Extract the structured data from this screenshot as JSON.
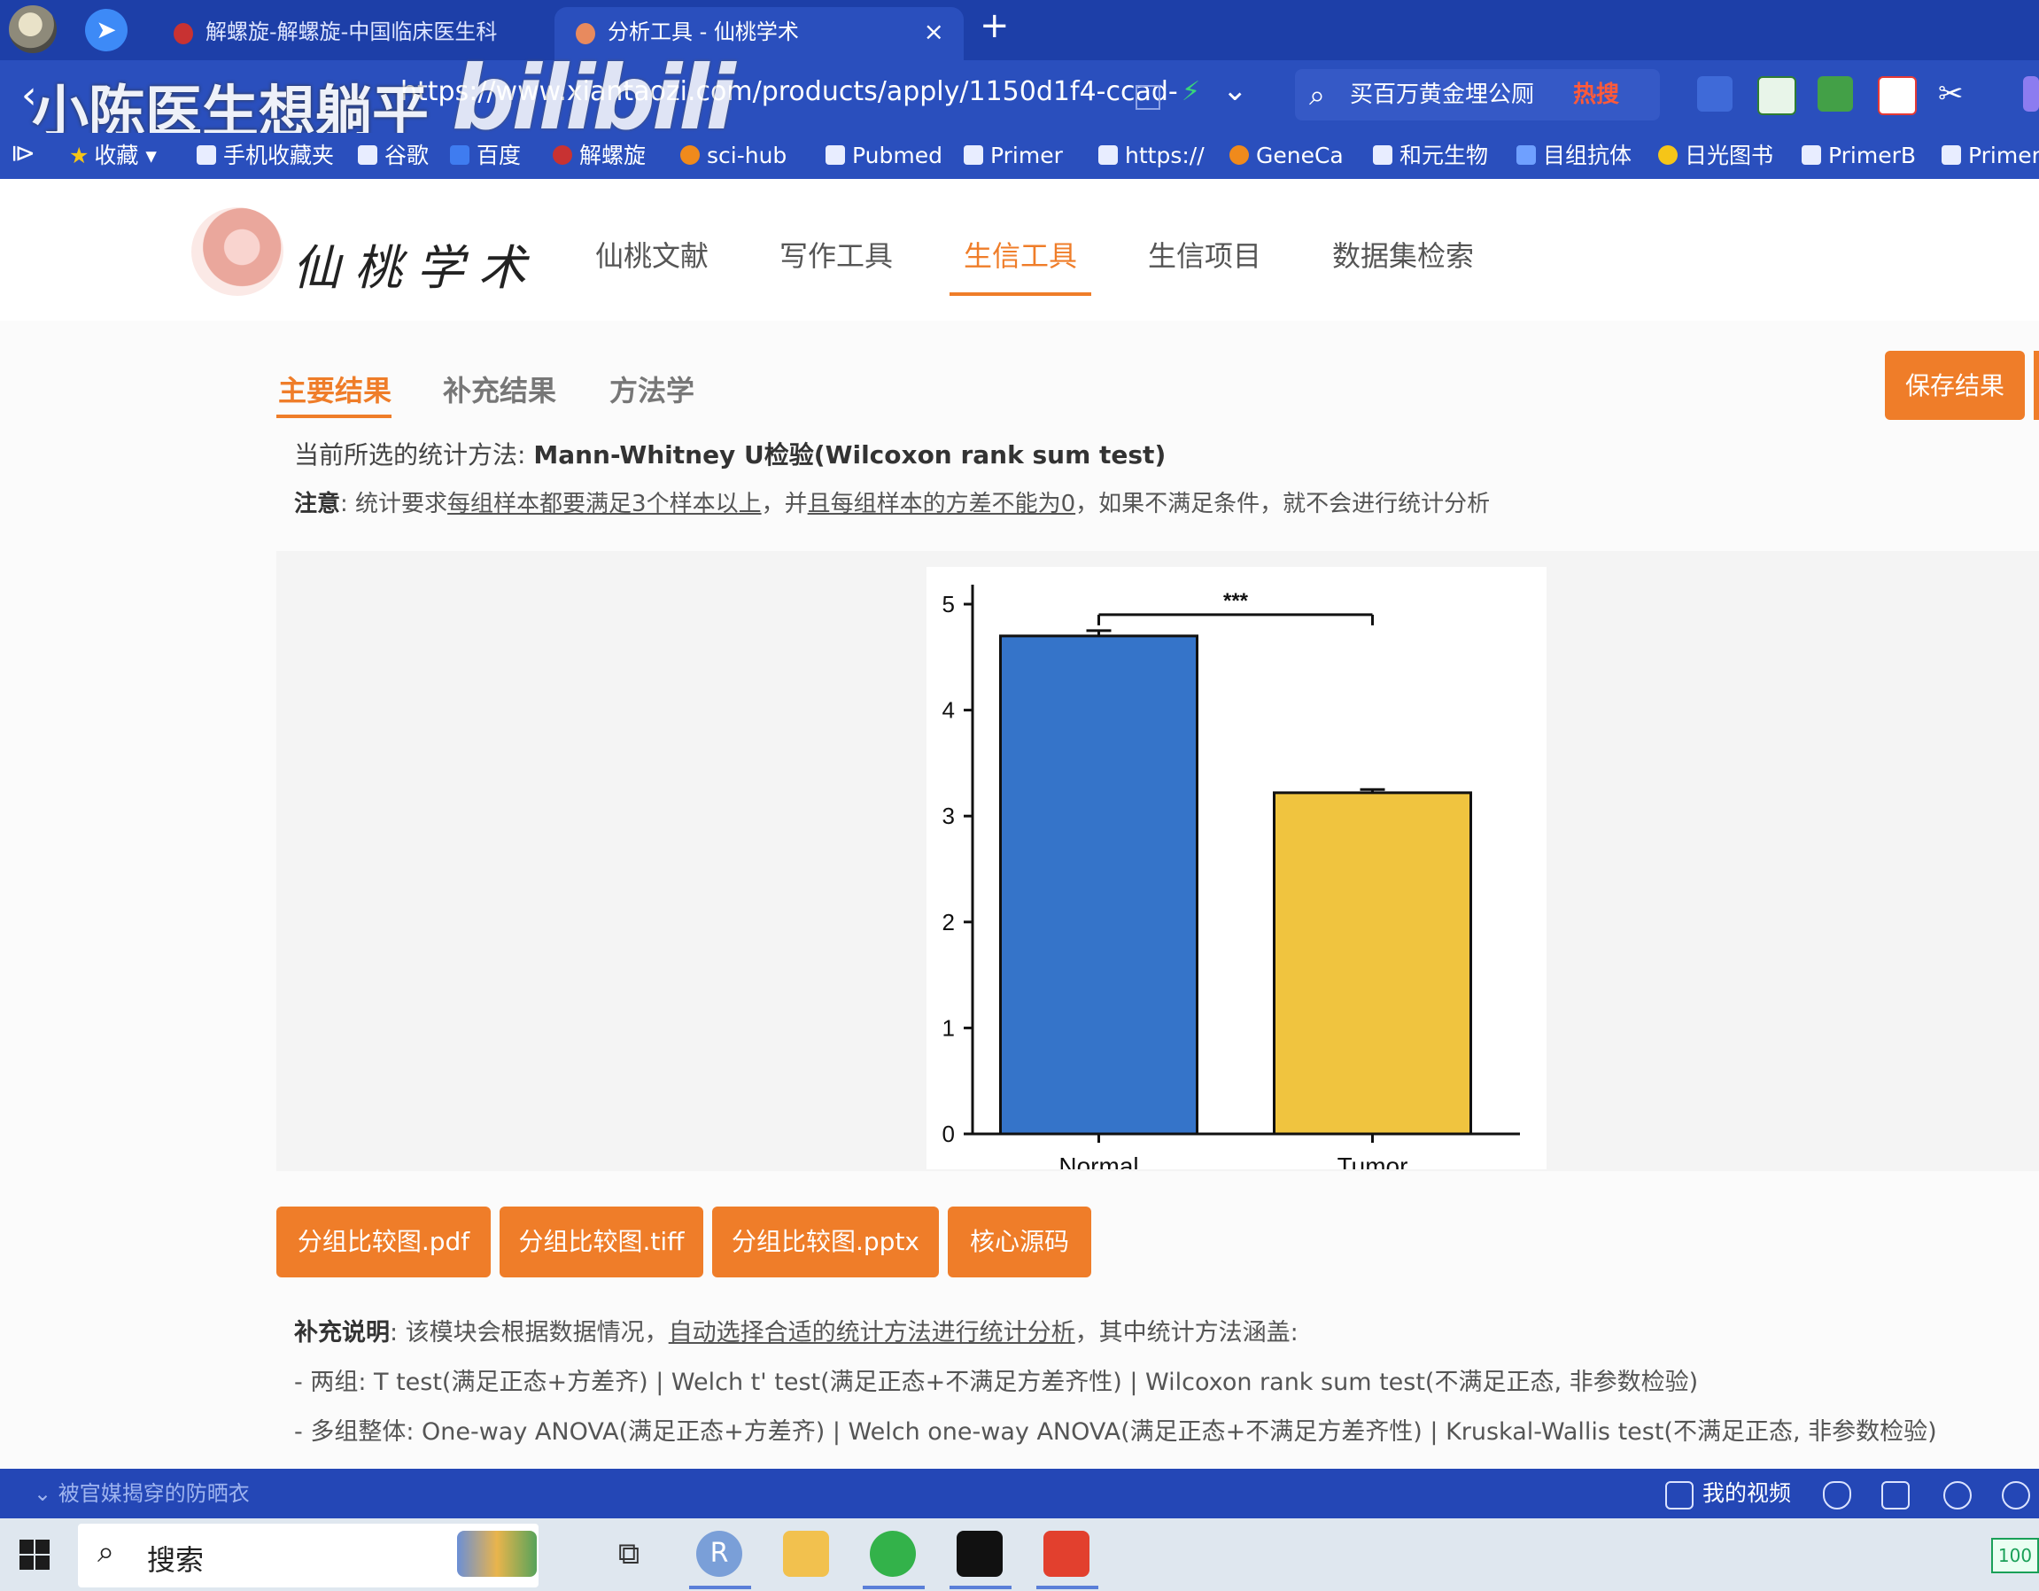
{
  "browser": {
    "tabs": [
      {
        "title": "解螺旋-解螺旋-中国临床医生科"
      },
      {
        "title": "分析工具 - 仙桃学术"
      }
    ],
    "tab_close": "×",
    "new_tab": "+",
    "url": "https://www.xiantaozi.com/products/apply/1150d1f4-ccad-",
    "search_text": "买百万黄金埋公厕",
    "search_hot": "热搜",
    "watermark": "小陈医生想躺平",
    "watermark_logo": "bilibili",
    "bookmarks": [
      "收藏",
      "手机收藏夹",
      "谷歌",
      "百度",
      "解螺旋",
      "sci-hub",
      "Pubmed",
      "Primer",
      "https://",
      "GeneCa",
      "和元生物",
      "目组抗体",
      "日光图书",
      "PrimerB",
      "Primer"
    ]
  },
  "site": {
    "brand": "仙桃学术",
    "nav": [
      "仙桃文献",
      "写作工具",
      "生信工具",
      "生信项目",
      "数据集检索"
    ],
    "active_nav": "生信工具"
  },
  "results": {
    "tabs": [
      "主要结果",
      "补充结果",
      "方法学"
    ],
    "active_tab": "主要结果",
    "save_label": "保存结果",
    "method_prefix": "当前所选的统计方法: ",
    "method_name": "Mann-Whitney U检验(Wilcoxon rank sum test)",
    "note_label": "注意",
    "note_p1": ": 统计要求",
    "note_u1": "每组样本都要满足3个样本以上",
    "note_p2": "，并",
    "note_u2": "且每组样本的方差不能为0",
    "note_p3": "，如果不满足条件，就不会进行统计分析",
    "download_buttons": [
      "分组比较图.pdf",
      "分组比较图.tiff",
      "分组比较图.pptx",
      "核心源码"
    ],
    "supp_label": "补充说明",
    "supp_p1": ": 该模块会根据数据情况，",
    "supp_u1": "自动选择合适的统计方法进行统计分析",
    "supp_p2": "，其中统计方法涵盖:",
    "supp_two_groups": "- 两组: T test(满足正态+方差齐) | Welch t' test(满足正态+不满足方差齐性) | Wilcoxon rank sum test(不满足正态, 非参数检验)",
    "supp_multi_groups": "- 多组整体: One-way ANOVA(满足正态+方差齐) | Welch one-way ANOVA(满足正态+不满足方差齐性) | Kruskal-Wallis test(不满足正态, 非参数检验)"
  },
  "chart_data": {
    "type": "bar",
    "categories": [
      "Normal",
      "Tumor"
    ],
    "values": [
      4.7,
      3.22
    ],
    "errors": [
      0.05,
      0.03
    ],
    "colors": [
      "#3574c9",
      "#f0c43f"
    ],
    "ylim": [
      0,
      5
    ],
    "yticks": [
      0,
      1,
      2,
      3,
      4,
      5
    ],
    "significance": "***",
    "title": "",
    "xlabel": "",
    "ylabel": ""
  },
  "statusbar": {
    "left_text": "被官媒揭穿的防晒衣",
    "right_text": "我的视频"
  },
  "taskbar": {
    "search": "搜索",
    "battery": "100"
  }
}
